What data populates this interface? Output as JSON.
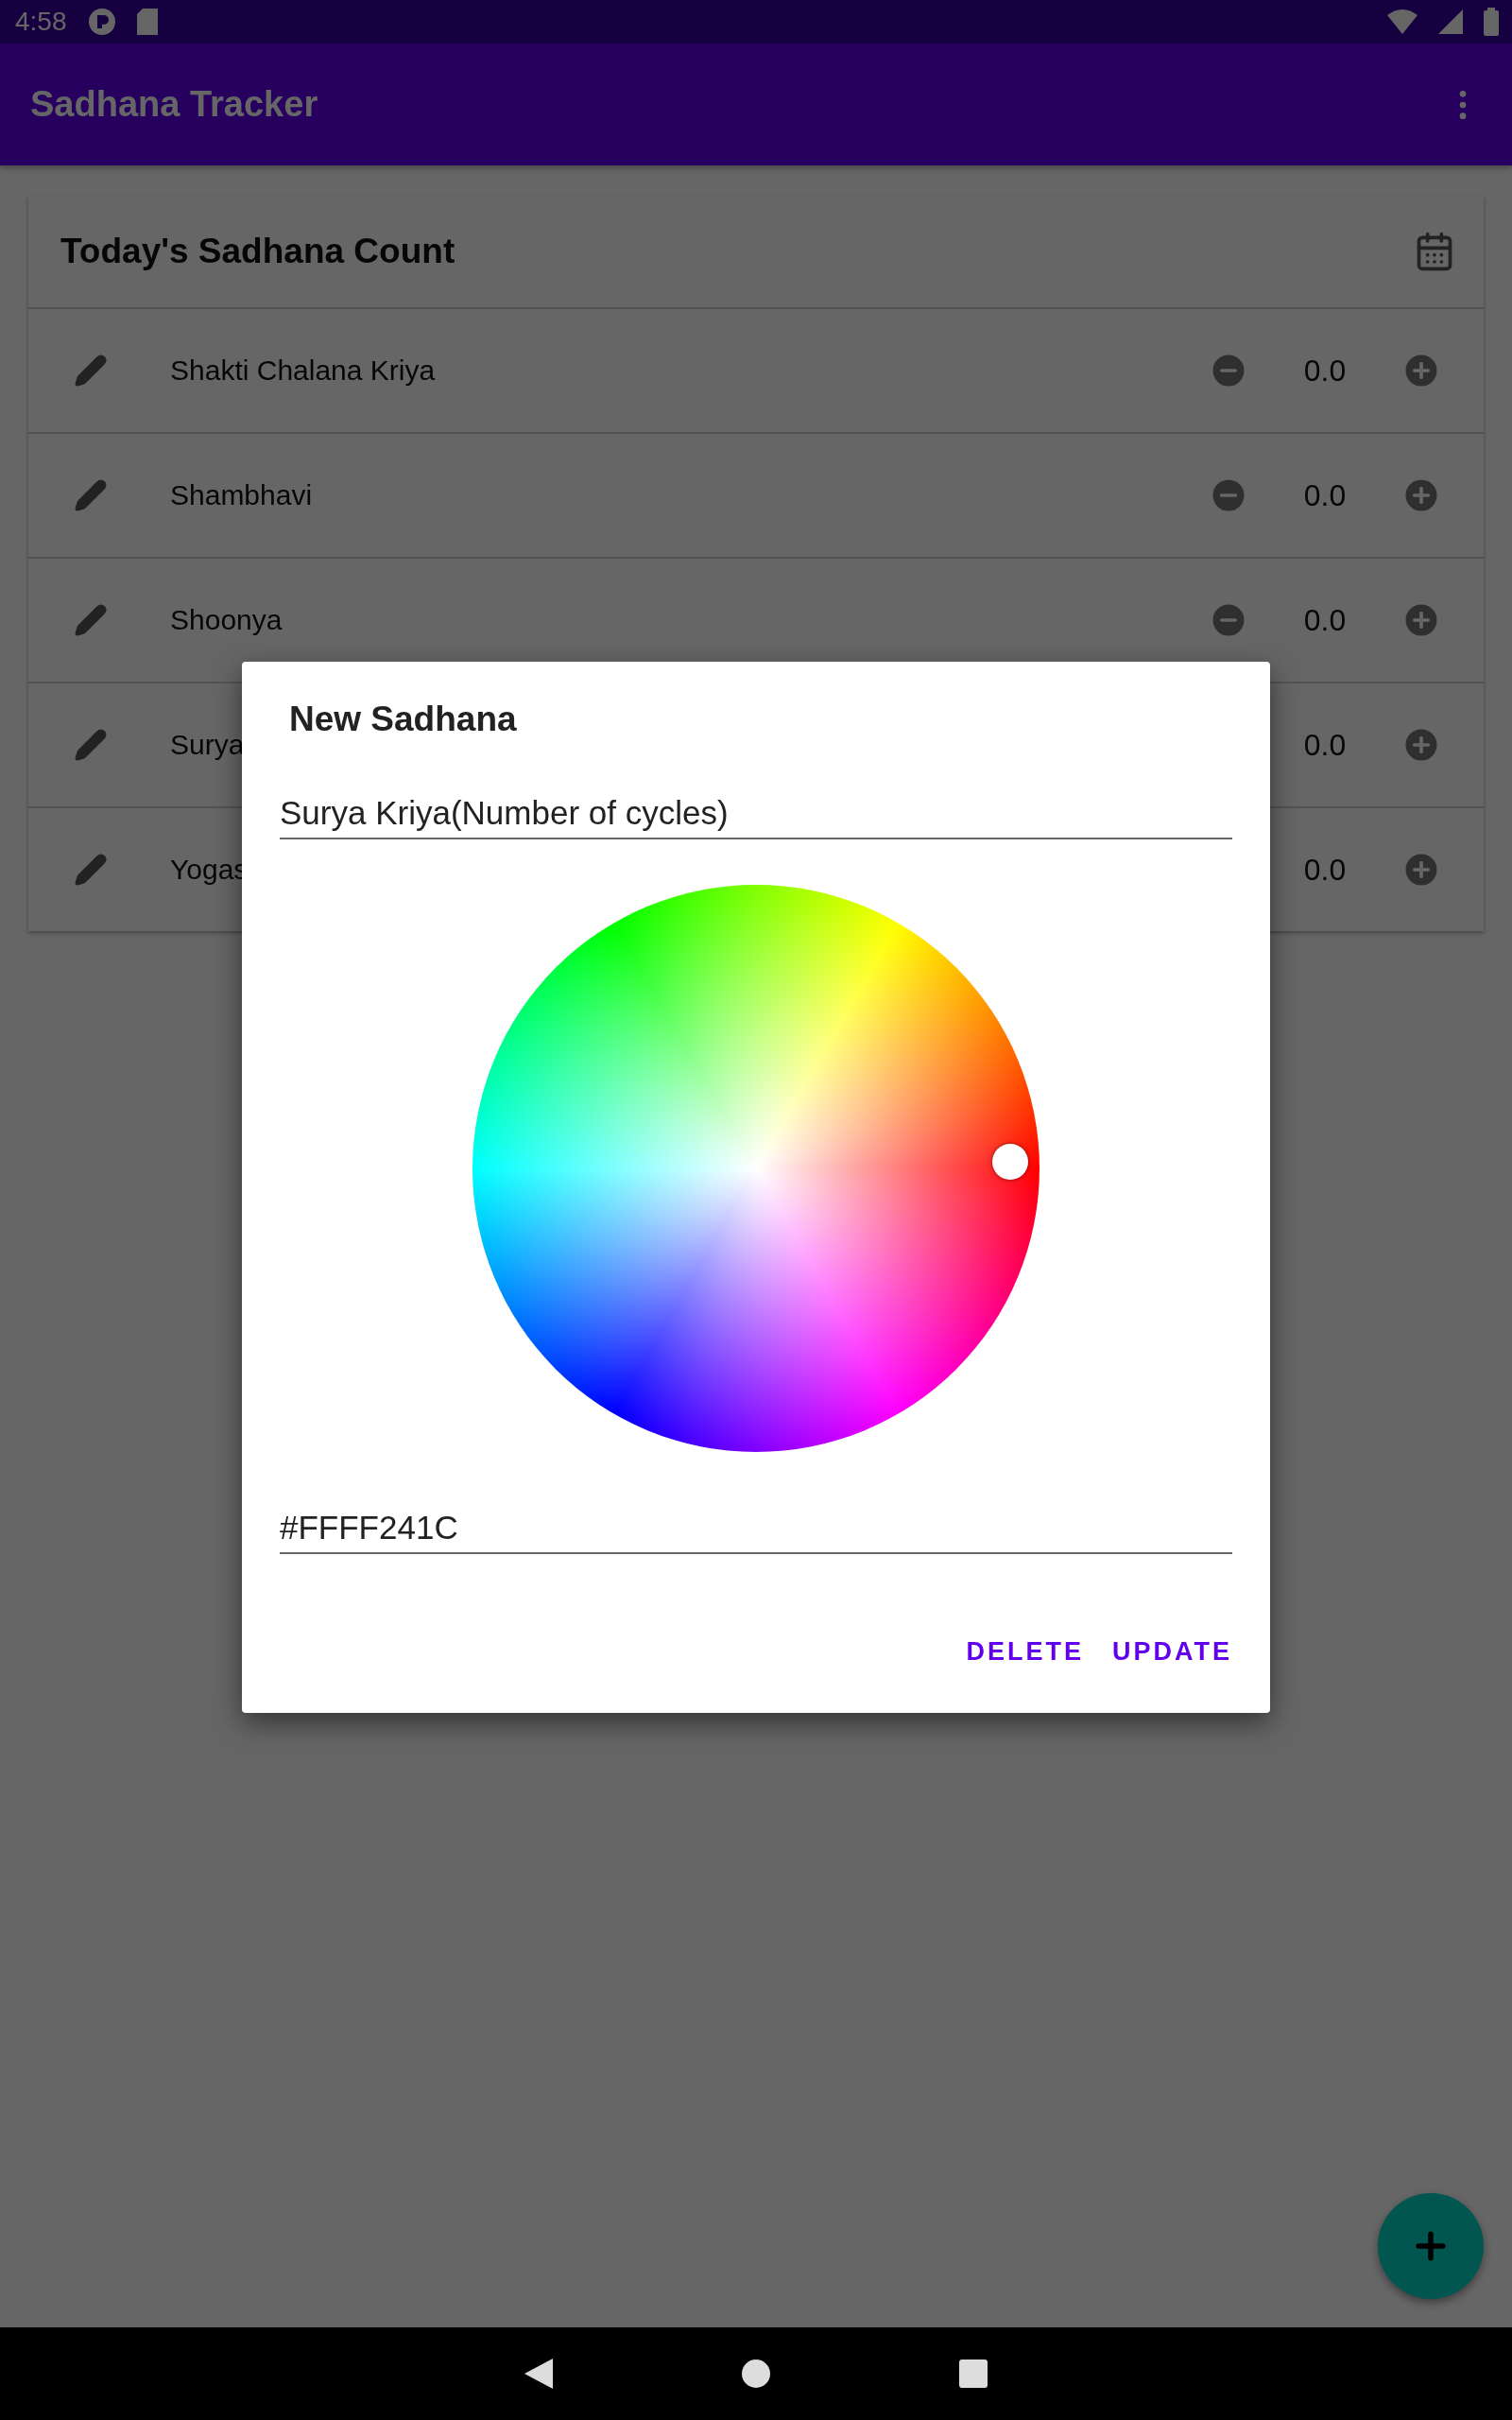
{
  "status_bar": {
    "time": "4:58"
  },
  "app_bar": {
    "title": "Sadhana Tracker"
  },
  "card": {
    "title": "Today's Sadhana Count",
    "rows": [
      {
        "name": "Shakti Chalana Kriya",
        "count": "0.0"
      },
      {
        "name": "Shambhavi",
        "count": "0.0"
      },
      {
        "name": "Shoonya",
        "count": "0.0"
      },
      {
        "name": "Surya",
        "count": "0.0"
      },
      {
        "name": "Yogas",
        "count": "0.0"
      }
    ]
  },
  "dialog": {
    "title": "New Sadhana",
    "name_value": "Surya Kriya(Number of cycles)",
    "color_value": "#FFFF241C",
    "buttons": [
      "DELETE",
      "UPDATE"
    ]
  }
}
